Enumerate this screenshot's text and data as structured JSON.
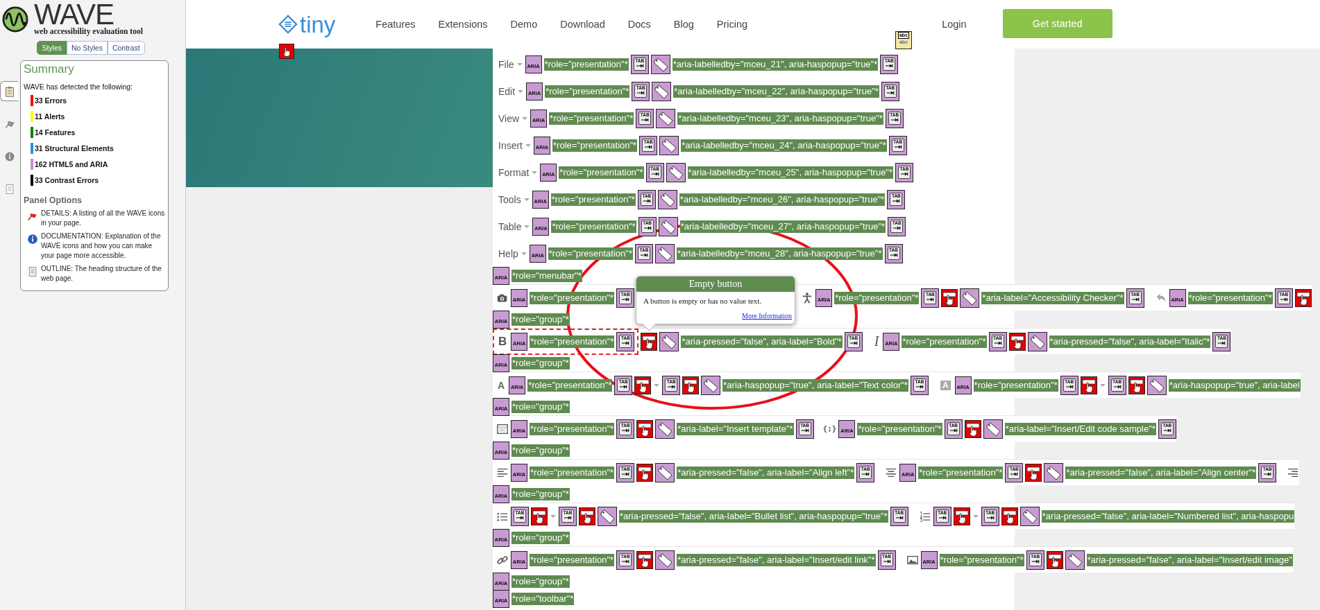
{
  "sidebar": {
    "logo_title": "WAVE",
    "logo_subtitle": "web accessibility evaluation tool",
    "view_tabs": [
      {
        "label": "Styles",
        "selected": true
      },
      {
        "label": "No Styles",
        "selected": false
      },
      {
        "label": "Contrast",
        "selected": false
      }
    ],
    "side_tabs": [
      {
        "kind": "summary",
        "selected": true
      },
      {
        "kind": "details",
        "selected": false
      },
      {
        "kind": "documentation",
        "selected": false
      },
      {
        "kind": "outline",
        "selected": false
      }
    ],
    "summary": {
      "title": "Summary",
      "intro": "WAVE has detected the following:",
      "items": [
        {
          "text": "33 Errors",
          "color": "#ff0000"
        },
        {
          "text": "11 Alerts",
          "color": "#ffff00"
        },
        {
          "text": "14 Features",
          "color": "#008000"
        },
        {
          "text": "31 Structural Elements",
          "color": "#2b8fe6"
        },
        {
          "text": "162 HTML5 and ARIA",
          "color": "#c88dd0"
        },
        {
          "text": "33 Contrast Errors",
          "color": "#000000"
        }
      ]
    },
    "panel_options": {
      "title": "Panel Options",
      "items": [
        {
          "kind": "details",
          "text": "DETAILS: A listing of all the WAVE icons in your page."
        },
        {
          "kind": "documentation",
          "text": "DOCUMENTATION: Explanation of the WAVE icons and how you can make your page more accessible."
        },
        {
          "kind": "outline",
          "text": "OUTLINE: The heading structure of the web page."
        }
      ]
    }
  },
  "nav": {
    "logo": "tiny",
    "links": [
      "Features",
      "Extensions",
      "Demo",
      "Download",
      "Docs",
      "Blog",
      "Pricing"
    ],
    "login": "Login",
    "cta": "Get started",
    "login_marker": [
      "abc",
      "abc"
    ]
  },
  "editor": {
    "rows": [
      {
        "kind": "menu",
        "tokens": [
          {
            "kind": "label",
            "text": "File"
          },
          {
            "kind": "caret"
          },
          {
            "kind": "aria",
            "text": "ARIA"
          },
          {
            "kind": "attr",
            "text": "*role=\"presentation\"*"
          },
          {
            "kind": "tab",
            "text": "TAB"
          },
          {
            "kind": "tag"
          },
          {
            "kind": "attr",
            "text": "*aria-labelledby=\"mceu_21\", aria-haspopup=\"true\"*"
          },
          {
            "kind": "tab",
            "text": "TAB"
          }
        ]
      },
      {
        "kind": "menu",
        "tokens": [
          {
            "kind": "label",
            "text": "Edit"
          },
          {
            "kind": "caret"
          },
          {
            "kind": "aria",
            "text": "ARIA"
          },
          {
            "kind": "attr",
            "text": "*role=\"presentation\"*"
          },
          {
            "kind": "tab",
            "text": "TAB"
          },
          {
            "kind": "tag"
          },
          {
            "kind": "attr",
            "text": "*aria-labelledby=\"mceu_22\", aria-haspopup=\"true\"*"
          },
          {
            "kind": "tab",
            "text": "TAB"
          }
        ]
      },
      {
        "kind": "menu",
        "tokens": [
          {
            "kind": "label",
            "text": "View"
          },
          {
            "kind": "caret"
          },
          {
            "kind": "aria",
            "text": "ARIA"
          },
          {
            "kind": "attr",
            "text": "*role=\"presentation\"*"
          },
          {
            "kind": "tab",
            "text": "TAB"
          },
          {
            "kind": "tag"
          },
          {
            "kind": "attr",
            "text": "*aria-labelledby=\"mceu_23\", aria-haspopup=\"true\"*"
          },
          {
            "kind": "tab",
            "text": "TAB"
          }
        ]
      },
      {
        "kind": "menu",
        "tokens": [
          {
            "kind": "label",
            "text": "Insert"
          },
          {
            "kind": "caret"
          },
          {
            "kind": "aria",
            "text": "ARIA"
          },
          {
            "kind": "attr",
            "text": "*role=\"presentation\"*"
          },
          {
            "kind": "tab",
            "text": "TAB"
          },
          {
            "kind": "tag"
          },
          {
            "kind": "attr",
            "text": "*aria-labelledby=\"mceu_24\", aria-haspopup=\"true\"*"
          },
          {
            "kind": "tab",
            "text": "TAB"
          }
        ]
      },
      {
        "kind": "menu",
        "tokens": [
          {
            "kind": "label",
            "text": "Format"
          },
          {
            "kind": "caret"
          },
          {
            "kind": "aria",
            "text": "ARIA"
          },
          {
            "kind": "attr",
            "text": "*role=\"presentation\"*"
          },
          {
            "kind": "tab",
            "text": "TAB"
          },
          {
            "kind": "tag"
          },
          {
            "kind": "attr",
            "text": "*aria-labelledby=\"mceu_25\", aria-haspopup=\"true\"*"
          },
          {
            "kind": "tab",
            "text": "TAB"
          }
        ]
      },
      {
        "kind": "menu",
        "tokens": [
          {
            "kind": "label",
            "text": "Tools"
          },
          {
            "kind": "caret"
          },
          {
            "kind": "aria",
            "text": "ARIA"
          },
          {
            "kind": "attr",
            "text": "*role=\"presentation\"*"
          },
          {
            "kind": "tab",
            "text": "TAB"
          },
          {
            "kind": "tag"
          },
          {
            "kind": "attr",
            "text": "*aria-labelledby=\"mceu_26\", aria-haspopup=\"true\"*"
          },
          {
            "kind": "tab",
            "text": "TAB"
          }
        ]
      },
      {
        "kind": "menu",
        "tokens": [
          {
            "kind": "label",
            "text": "Table"
          },
          {
            "kind": "caret"
          },
          {
            "kind": "aria",
            "text": "ARIA"
          },
          {
            "kind": "attr",
            "text": "*role=\"presentation\"*"
          },
          {
            "kind": "tab",
            "text": "TAB"
          },
          {
            "kind": "tag"
          },
          {
            "kind": "attr",
            "text": "*aria-labelledby=\"mceu_27\", aria-haspopup=\"true\"*"
          },
          {
            "kind": "tab",
            "text": "TAB"
          }
        ]
      },
      {
        "kind": "menu",
        "tokens": [
          {
            "kind": "label",
            "text": "Help"
          },
          {
            "kind": "caret"
          },
          {
            "kind": "aria",
            "text": "ARIA"
          },
          {
            "kind": "attr",
            "text": "*role=\"presentation\"*"
          },
          {
            "kind": "tab",
            "text": "TAB"
          },
          {
            "kind": "tag"
          },
          {
            "kind": "attr",
            "text": "*aria-labelledby=\"mceu_28\", aria-haspopup=\"true\"*"
          },
          {
            "kind": "tab",
            "text": "TAB"
          }
        ]
      },
      {
        "kind": "line",
        "tokens": [
          {
            "kind": "aria",
            "text": "ARIA"
          },
          {
            "kind": "attr",
            "text": "*role=\"menubar\"*"
          }
        ]
      },
      {
        "kind": "toolbar",
        "tokens": [
          {
            "kind": "camera"
          },
          {
            "kind": "aria",
            "text": "ARIA"
          },
          {
            "kind": "attr",
            "text": "*role=\"presentation\"*"
          },
          {
            "kind": "tab",
            "text": "TAB"
          },
          {
            "kind": "covered"
          },
          {
            "kind": "person"
          },
          {
            "kind": "aria",
            "text": "ARIA"
          },
          {
            "kind": "attr",
            "text": "*role=\"presentation\"*"
          },
          {
            "kind": "tab",
            "text": "TAB"
          },
          {
            "kind": "button"
          },
          {
            "kind": "tag"
          },
          {
            "kind": "attr",
            "text": "*aria-label=\"Accessibility Checker\"*"
          },
          {
            "kind": "tab",
            "text": "TAB"
          },
          {
            "kind": "undo"
          },
          {
            "kind": "aria",
            "text": "ARIA"
          },
          {
            "kind": "attr",
            "text": "*role=\"presentation\"*"
          },
          {
            "kind": "tab",
            "text": "TAB"
          },
          {
            "kind": "button"
          }
        ]
      },
      {
        "kind": "line",
        "tokens": [
          {
            "kind": "aria",
            "text": "ARIA"
          },
          {
            "kind": "attr",
            "text": "*role=\"group\"*"
          }
        ]
      },
      {
        "kind": "toolbar",
        "tokens": [
          {
            "kind": "outline",
            "tokens": [
              {
                "kind": "bold",
                "text": "B"
              },
              {
                "kind": "aria",
                "text": "ARIA"
              },
              {
                "kind": "attr",
                "text": "*role=\"presentation\"*"
              },
              {
                "kind": "tab",
                "text": "TAB"
              }
            ]
          },
          {
            "kind": "button"
          },
          {
            "kind": "tag"
          },
          {
            "kind": "attr",
            "text": "*aria-pressed=\"false\", aria-label=\"Bold\"*"
          },
          {
            "kind": "tab",
            "text": "TAB"
          },
          {
            "kind": "italic",
            "text": "I"
          },
          {
            "kind": "aria",
            "text": "ARIA"
          },
          {
            "kind": "attr",
            "text": "*role=\"presentation\"*"
          },
          {
            "kind": "tab",
            "text": "TAB"
          },
          {
            "kind": "button"
          },
          {
            "kind": "tag"
          },
          {
            "kind": "attr",
            "text": "*aria-pressed=\"false\", aria-label=\"Italic\"*"
          },
          {
            "kind": "tab",
            "text": "TAB"
          }
        ]
      },
      {
        "kind": "line",
        "tokens": [
          {
            "kind": "aria",
            "text": "ARIA"
          },
          {
            "kind": "attr",
            "text": "*role=\"group\"*"
          }
        ]
      },
      {
        "kind": "toolbar",
        "tokens": [
          {
            "kind": "letter",
            "text": "A"
          },
          {
            "kind": "aria",
            "text": "ARIA"
          },
          {
            "kind": "attr",
            "text": "*role=\"presentation\"*"
          },
          {
            "kind": "tab",
            "text": "TAB"
          },
          {
            "kind": "button"
          },
          {
            "kind": "caret"
          },
          {
            "kind": "tab",
            "text": "TAB"
          },
          {
            "kind": "button"
          },
          {
            "kind": "tag"
          },
          {
            "kind": "attr",
            "text": "*aria-haspopup=\"true\", aria-label=\"Text color\"*"
          },
          {
            "kind": "tab",
            "text": "TAB"
          },
          {
            "kind": "boxed",
            "text": "A"
          },
          {
            "kind": "aria",
            "text": "ARIA"
          },
          {
            "kind": "attr",
            "text": "*role=\"presentation\"*"
          },
          {
            "kind": "tab",
            "text": "TAB"
          },
          {
            "kind": "button"
          },
          {
            "kind": "caret"
          },
          {
            "kind": "tab",
            "text": "TAB"
          },
          {
            "kind": "button"
          },
          {
            "kind": "tag"
          },
          {
            "kind": "attr",
            "text": "*aria-haspopup=\"true\", aria-label"
          }
        ]
      },
      {
        "kind": "line",
        "tokens": [
          {
            "kind": "aria",
            "text": "ARIA"
          },
          {
            "kind": "attr",
            "text": "*role=\"group\"*"
          }
        ]
      },
      {
        "kind": "toolbar",
        "tokens": [
          {
            "kind": "template"
          },
          {
            "kind": "aria",
            "text": "ARIA"
          },
          {
            "kind": "attr",
            "text": "*role=\"presentation\"*"
          },
          {
            "kind": "tab",
            "text": "TAB"
          },
          {
            "kind": "button"
          },
          {
            "kind": "tag"
          },
          {
            "kind": "attr",
            "text": "*aria-label=\"Insert template\"*"
          },
          {
            "kind": "tab",
            "text": "TAB"
          },
          {
            "kind": "code",
            "text": "{;}"
          },
          {
            "kind": "aria",
            "text": "ARIA"
          },
          {
            "kind": "attr",
            "text": "*role=\"presentation\"*"
          },
          {
            "kind": "tab",
            "text": "TAB"
          },
          {
            "kind": "button"
          },
          {
            "kind": "tag"
          },
          {
            "kind": "attr",
            "text": "*aria-label=\"Insert/Edit code sample\"*"
          },
          {
            "kind": "tab",
            "text": "TAB"
          }
        ]
      },
      {
        "kind": "line",
        "tokens": [
          {
            "kind": "aria",
            "text": "ARIA"
          },
          {
            "kind": "attr",
            "text": "*role=\"group\"*"
          }
        ]
      },
      {
        "kind": "toolbar",
        "tokens": [
          {
            "kind": "alignleft"
          },
          {
            "kind": "aria",
            "text": "ARIA"
          },
          {
            "kind": "attr",
            "text": "*role=\"presentation\"*"
          },
          {
            "kind": "tab",
            "text": "TAB"
          },
          {
            "kind": "button"
          },
          {
            "kind": "tag"
          },
          {
            "kind": "attr",
            "text": "*aria-pressed=\"false\", aria-label=\"Align left\"*"
          },
          {
            "kind": "tab",
            "text": "TAB"
          },
          {
            "kind": "aligncenter"
          },
          {
            "kind": "aria",
            "text": "ARIA"
          },
          {
            "kind": "attr",
            "text": "*role=\"presentation\"*"
          },
          {
            "kind": "tab",
            "text": "TAB"
          },
          {
            "kind": "button"
          },
          {
            "kind": "tag"
          },
          {
            "kind": "attr",
            "text": "*aria-pressed=\"false\", aria-label=\"Align center\"*"
          },
          {
            "kind": "tab",
            "text": "TAB"
          },
          {
            "kind": "alignright"
          }
        ]
      },
      {
        "kind": "line",
        "tokens": [
          {
            "kind": "aria",
            "text": "ARIA"
          },
          {
            "kind": "attr",
            "text": "*role=\"group\"*"
          }
        ]
      },
      {
        "kind": "toolbar",
        "tokens": [
          {
            "kind": "bullets"
          },
          {
            "kind": "tab",
            "text": "TAB"
          },
          {
            "kind": "button"
          },
          {
            "kind": "caret"
          },
          {
            "kind": "tab",
            "text": "TAB"
          },
          {
            "kind": "button"
          },
          {
            "kind": "tag"
          },
          {
            "kind": "attr",
            "text": "*aria-pressed=\"false\", aria-label=\"Bullet list\", aria-haspopup=\"true\"*"
          },
          {
            "kind": "tab",
            "text": "TAB"
          },
          {
            "kind": "numbers"
          },
          {
            "kind": "tab",
            "text": "TAB"
          },
          {
            "kind": "button"
          },
          {
            "kind": "caret"
          },
          {
            "kind": "tab",
            "text": "TAB"
          },
          {
            "kind": "button"
          },
          {
            "kind": "tag"
          },
          {
            "kind": "attr",
            "text": "*aria-pressed=\"false\", aria-label=\"Numbered list\", aria-haspopu"
          }
        ]
      },
      {
        "kind": "line",
        "tokens": [
          {
            "kind": "aria",
            "text": "ARIA"
          },
          {
            "kind": "attr",
            "text": "*role=\"group\"*"
          }
        ]
      },
      {
        "kind": "toolbar",
        "tokens": [
          {
            "kind": "link"
          },
          {
            "kind": "aria",
            "text": "ARIA"
          },
          {
            "kind": "attr",
            "text": "*role=\"presentation\"*"
          },
          {
            "kind": "tab",
            "text": "TAB"
          },
          {
            "kind": "button"
          },
          {
            "kind": "tag"
          },
          {
            "kind": "attr",
            "text": "*aria-pressed=\"false\", aria-label=\"Insert/edit link\"*"
          },
          {
            "kind": "tab",
            "text": "TAB"
          },
          {
            "kind": "image"
          },
          {
            "kind": "aria",
            "text": "ARIA"
          },
          {
            "kind": "attr",
            "text": "*role=\"presentation\"*"
          },
          {
            "kind": "tab",
            "text": "TAB"
          },
          {
            "kind": "button"
          },
          {
            "kind": "tag"
          },
          {
            "kind": "attr",
            "text": "*aria-pressed=\"false\", aria-label=\"Insert/edit image\""
          }
        ]
      },
      {
        "kind": "line",
        "tokens": [
          {
            "kind": "aria",
            "text": "ARIA"
          },
          {
            "kind": "attr",
            "text": "*role=\"group\"*"
          }
        ]
      },
      {
        "kind": "line",
        "tokens": [
          {
            "kind": "aria",
            "text": "ARIA"
          },
          {
            "kind": "attr",
            "text": "*role=\"toolbar\"*"
          }
        ]
      }
    ]
  },
  "tooltip": {
    "title": "Empty button",
    "text": "A button is empty or has no value text.",
    "link": "More Information"
  }
}
